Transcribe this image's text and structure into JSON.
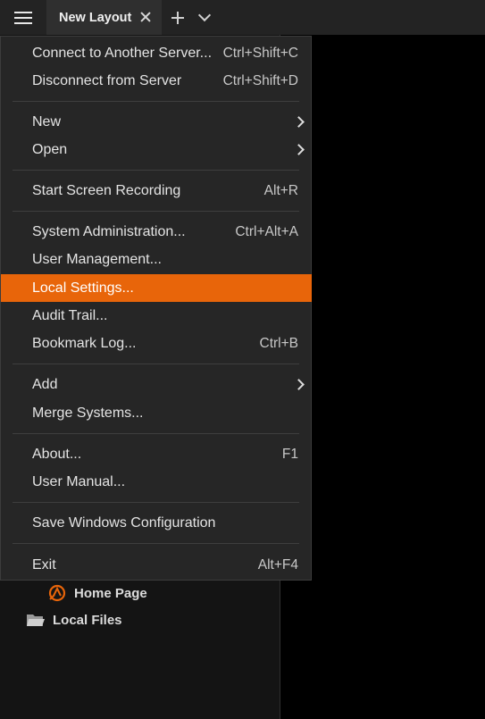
{
  "topbar": {
    "tab_label": "New Layout"
  },
  "tree": {
    "home_page": "Home Page",
    "local_files": "Local Files"
  },
  "menu": {
    "items": [
      {
        "label": "Connect to Another Server...",
        "shortcut": "Ctrl+Shift+C"
      },
      {
        "label": "Disconnect from Server",
        "shortcut": "Ctrl+Shift+D"
      },
      {
        "label": "New",
        "shortcut": ""
      },
      {
        "label": "Open",
        "shortcut": ""
      },
      {
        "label": "Start Screen Recording",
        "shortcut": "Alt+R"
      },
      {
        "label": "System Administration...",
        "shortcut": "Ctrl+Alt+A"
      },
      {
        "label": "User Management...",
        "shortcut": ""
      },
      {
        "label": "Local Settings...",
        "shortcut": ""
      },
      {
        "label": "Audit Trail...",
        "shortcut": ""
      },
      {
        "label": "Bookmark Log...",
        "shortcut": "Ctrl+B"
      },
      {
        "label": "Add",
        "shortcut": ""
      },
      {
        "label": "Merge Systems...",
        "shortcut": ""
      },
      {
        "label": "About...",
        "shortcut": "F1"
      },
      {
        "label": "User Manual...",
        "shortcut": ""
      },
      {
        "label": "Save Windows Configuration",
        "shortcut": ""
      },
      {
        "label": "Exit",
        "shortcut": "Alt+F4"
      }
    ]
  },
  "colors": {
    "accent": "#e8650a",
    "menu_bg": "#262626",
    "topbar_bg": "#232323"
  }
}
